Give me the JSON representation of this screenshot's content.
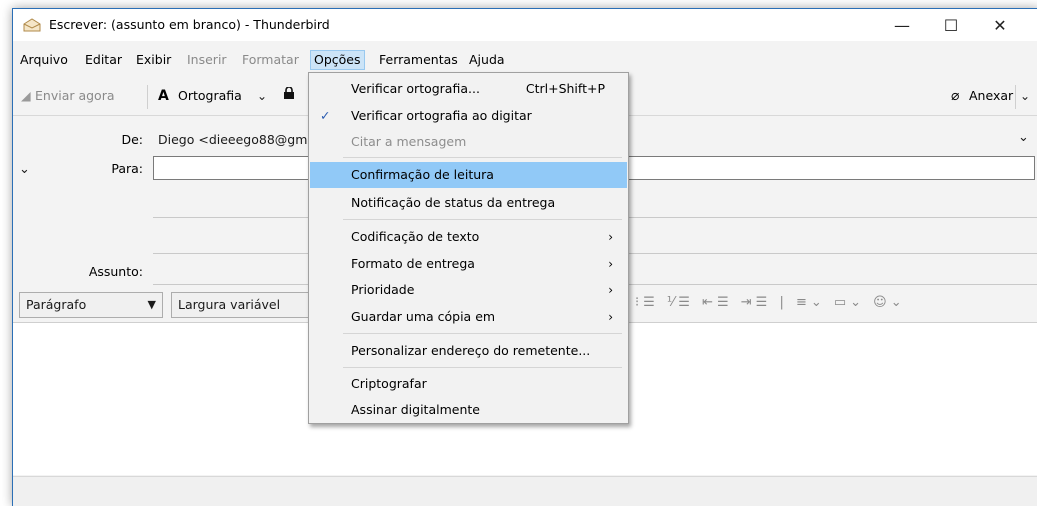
{
  "window": {
    "title": "Escrever: (assunto em branco) - Thunderbird",
    "minimize": "—",
    "maximize": "☐",
    "close": "✕"
  },
  "menubar": {
    "items": [
      {
        "label": "Arquivo",
        "enabled": true
      },
      {
        "label": "Editar",
        "enabled": true
      },
      {
        "label": "Exibir",
        "enabled": true
      },
      {
        "label": "Inserir",
        "enabled": false
      },
      {
        "label": "Formatar",
        "enabled": false
      },
      {
        "label": "Opções",
        "enabled": true,
        "open": true
      },
      {
        "label": "Ferramentas",
        "enabled": true
      },
      {
        "label": "Ajuda",
        "enabled": true
      }
    ]
  },
  "toolbar": {
    "send_label": "Enviar agora",
    "spell_label": "Ortografia",
    "attach_label": "Anexar",
    "dropdown_glyph": "⌄"
  },
  "headers": {
    "from_label": "De:",
    "from_value": "Diego <dieeego88@gm",
    "to_label": "Para:",
    "to_value": "",
    "subject_label": "Assunto:",
    "subject_value": ""
  },
  "format": {
    "paragraph_value": "Parágrafo",
    "font_value": "Largura variável",
    "icons": "⁝☰ ⅟☰ ⇤☰ ⇥☰ | ≡⌄ ▭⌄ ☺⌄"
  },
  "options_menu": {
    "items": [
      {
        "label": "Verificar ortografia...",
        "shortcut": "Ctrl+Shift+P",
        "enabled": true
      },
      {
        "label": "Verificar ortografia ao digitar",
        "enabled": true,
        "checked": true
      },
      {
        "label": "Citar a mensagem",
        "enabled": false
      },
      {
        "label": "Confirmação de leitura",
        "enabled": true,
        "highlighted": true
      },
      {
        "label": "Notificação de status da entrega",
        "enabled": true
      },
      {
        "label": "Codificação de texto",
        "enabled": true,
        "submenu": true
      },
      {
        "label": "Formato de entrega",
        "enabled": true,
        "submenu": true
      },
      {
        "label": "Prioridade",
        "enabled": true,
        "submenu": true
      },
      {
        "label": "Guardar uma cópia em",
        "enabled": true,
        "submenu": true
      },
      {
        "label": "Personalizar endereço do remetente...",
        "enabled": true
      },
      {
        "label": "Criptografar",
        "enabled": true
      },
      {
        "label": "Assinar digitalmente",
        "enabled": true
      }
    ],
    "check_glyph": "✓",
    "submenu_glyph": "›"
  },
  "colors": {
    "highlight": "#91c9f7",
    "menu_active": "#cce4f7",
    "window_border": "#2b6fb6"
  }
}
